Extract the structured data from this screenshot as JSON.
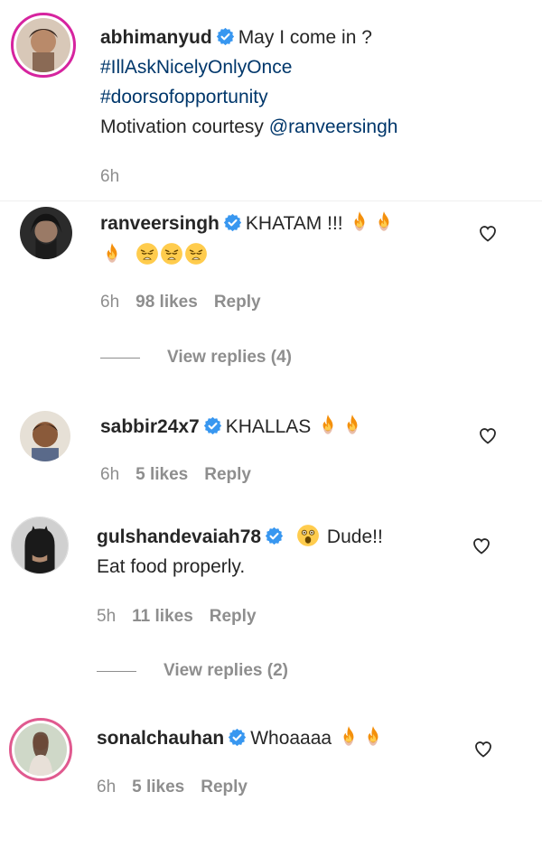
{
  "caption": {
    "username": "abhimanyud",
    "line1": "May I come in ?",
    "hashtag1": "#IllAskNicelyOnlyOnce",
    "hashtag2": "#doorsofopportunity",
    "line4_prefix": "Motivation courtesy ",
    "mention": "@ranveersingh",
    "time": "6h"
  },
  "comments": [
    {
      "username": "ranveersingh",
      "text": "KHATAM !!!",
      "time": "6h",
      "likes": "98 likes",
      "reply": "Reply",
      "view_replies": "View replies (4)",
      "emojis_line1": [
        "fire-icon",
        "fire-icon"
      ],
      "emojis_line2": [
        "fire-icon",
        "weary-face-icon",
        "weary-face-icon",
        "weary-face-icon"
      ]
    },
    {
      "username": "sabbir24x7",
      "text": "KHALLAS",
      "time": "6h",
      "likes": "5 likes",
      "reply": "Reply",
      "emojis_line1": [
        "fire-icon",
        "fire-icon"
      ]
    },
    {
      "username": "gulshandevaiah78",
      "text": "Dude!!",
      "text2": "Eat food properly.",
      "time": "5h",
      "likes": "11 likes",
      "reply": "Reply",
      "view_replies": "View replies (2)",
      "emojis_before": [
        "astonished-face-icon"
      ]
    },
    {
      "username": "sonalchauhan",
      "text": "Whoaaaa",
      "time": "6h",
      "likes": "5 likes",
      "reply": "Reply",
      "emojis_line1": [
        "fire-icon",
        "fire-icon"
      ]
    }
  ],
  "colors": {
    "text": "#262626",
    "secondary": "#8e8e8e",
    "link": "#00376b",
    "verified": "#3897f0",
    "story_ring": "#d6249f"
  }
}
